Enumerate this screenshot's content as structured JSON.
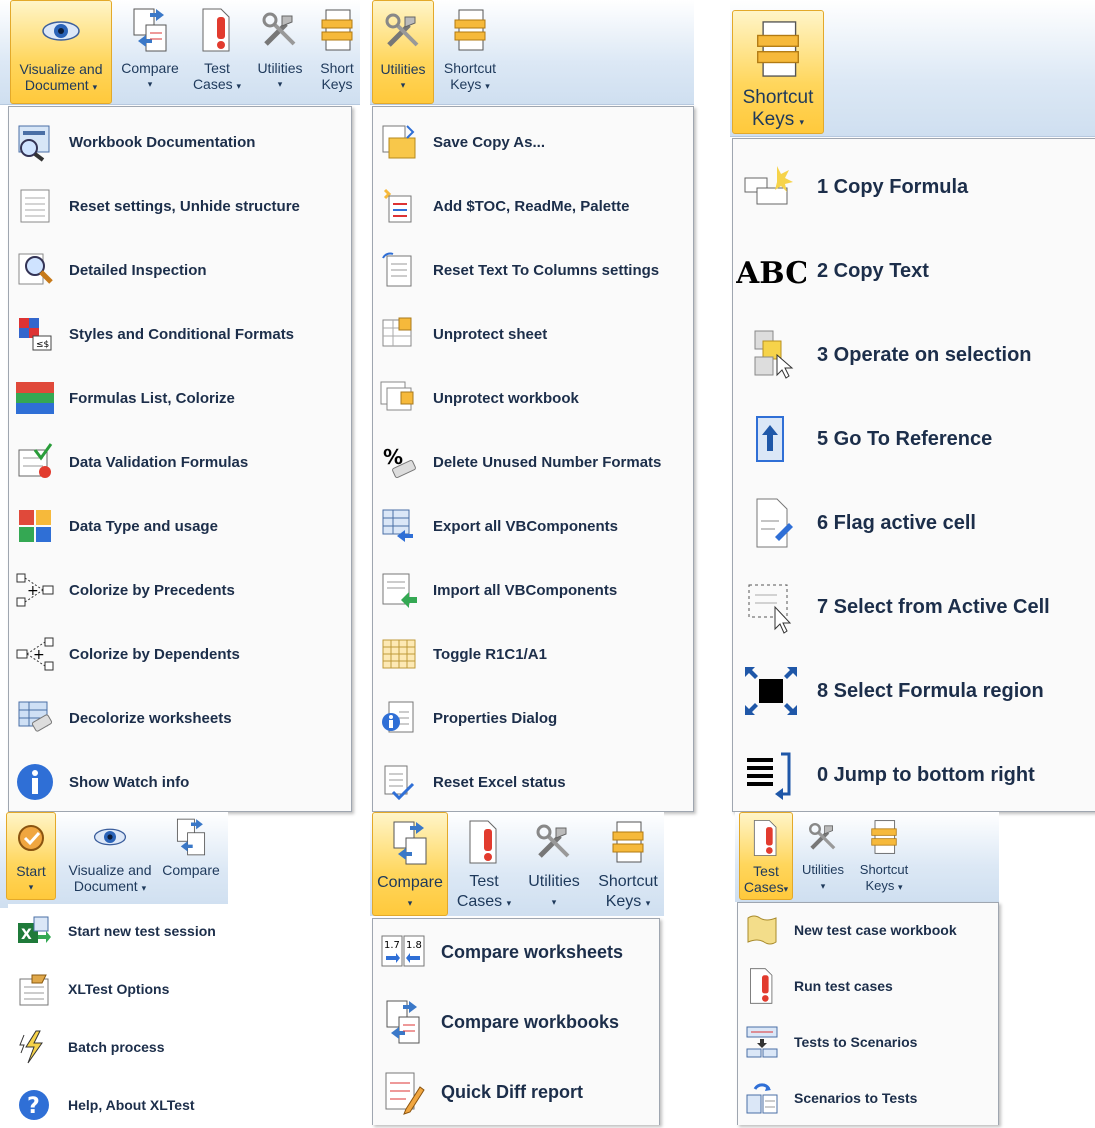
{
  "p1": {
    "ribbon": [
      {
        "line1": "Visualize and",
        "line2": "Document",
        "arrow": "▾",
        "icon": "eye-icon"
      },
      {
        "line1": "Compare",
        "line2": "",
        "arrow": "▾",
        "icon": "compare-icon"
      },
      {
        "line1": "Test",
        "line2": "Cases",
        "arrow": "▾",
        "icon": "test-cases-icon"
      },
      {
        "line1": "Utilities",
        "line2": "",
        "arrow": "▾",
        "icon": "utilities-icon"
      },
      {
        "line1": "Short",
        "line2": "Keys",
        "arrow": "",
        "icon": "shortcut-icon"
      }
    ],
    "items": [
      "Workbook Documentation",
      "Reset settings, Unhide structure",
      "Detailed Inspection",
      "Styles and Conditional Formats",
      "Formulas List, Colorize",
      "Data Validation Formulas",
      "Data Type and usage",
      "Colorize by Precedents",
      "Colorize by Dependents",
      "Decolorize worksheets",
      "Show Watch info"
    ]
  },
  "p2": {
    "ribbon": [
      {
        "line1": "Utilities",
        "line2": "",
        "arrow": "▾",
        "icon": "utilities-icon"
      },
      {
        "line1": "Shortcut",
        "line2": "Keys",
        "arrow": "▾",
        "icon": "shortcut-icon"
      }
    ],
    "items": [
      "Save Copy As...",
      "Add $TOC, ReadMe, Palette",
      "Reset Text To Columns settings",
      "Unprotect sheet",
      "Unprotect workbook",
      "Delete Unused Number Formats",
      "Export all VBComponents",
      "Import all VBComponents",
      "Toggle R1C1/A1",
      "Properties Dialog",
      "Reset Excel status"
    ]
  },
  "p3": {
    "ribbon": [
      {
        "line1": "Shortcut",
        "line2": "Keys",
        "arrow": "▾",
        "icon": "shortcut-icon"
      }
    ],
    "items": [
      "1 Copy Formula",
      "2 Copy Text",
      "3 Operate on selection",
      "5 Go To Reference",
      "6 Flag active cell",
      "7 Select from Active Cell",
      "8 Select Formula region",
      "0 Jump to bottom right"
    ]
  },
  "p4": {
    "ribbon": [
      {
        "line1": "Start",
        "line2": "",
        "arrow": "▾",
        "icon": "start-icon"
      },
      {
        "line1": "Visualize and",
        "line2": "Document",
        "arrow": "▾",
        "icon": "eye-icon"
      },
      {
        "line1": "Compare",
        "line2": "",
        "arrow": "",
        "icon": "compare-icon"
      }
    ],
    "items": [
      "Start new test session",
      "XLTest Options",
      "Batch process",
      "Help, About XLTest"
    ]
  },
  "p5": {
    "ribbon": [
      {
        "line1": "Compare",
        "line2": "",
        "arrow": "▾",
        "icon": "compare-icon"
      },
      {
        "line1": "Test",
        "line2": "Cases",
        "arrow": "▾",
        "icon": "test-cases-icon"
      },
      {
        "line1": "Utilities",
        "line2": "",
        "arrow": "▾",
        "icon": "utilities-icon"
      },
      {
        "line1": "Shortcut",
        "line2": "Keys",
        "arrow": "▾",
        "icon": "shortcut-icon"
      }
    ],
    "items": [
      "Compare worksheets",
      "Compare workbooks",
      "Quick Diff report"
    ]
  },
  "p6": {
    "ribbon": [
      {
        "line1": "Test",
        "line2": "Cases",
        "arrow": "▾",
        "icon": "test-cases-icon"
      },
      {
        "line1": "Utilities",
        "line2": "",
        "arrow": "▾",
        "icon": "utilities-icon"
      },
      {
        "line1": "Shortcut",
        "line2": "Keys",
        "arrow": "▾",
        "icon": "shortcut-icon"
      }
    ],
    "items": [
      "New test case workbook",
      "Run test cases",
      "Tests to Scenarios",
      "Scenarios to Tests"
    ]
  },
  "colors": {
    "accent": "#ffd65c",
    "menu_text": "#1c2e4a",
    "ribbon_text": "#1e395b"
  }
}
